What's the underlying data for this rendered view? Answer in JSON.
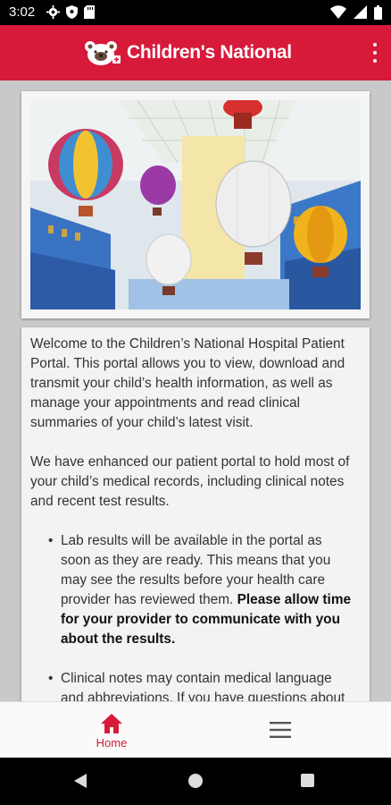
{
  "status_bar": {
    "time": "3:02",
    "left_icons": [
      "gear-icon",
      "shield-icon",
      "sd-card-icon"
    ],
    "right_icons": [
      "wifi-icon",
      "signal-icon",
      "battery-icon"
    ]
  },
  "app_bar": {
    "brand_name": "Children's National",
    "brand_color": "#d71a3a",
    "overflow_icon": "more-vertical-icon"
  },
  "hero_image": {
    "subject": "hot air balloons in hospital atrium"
  },
  "intro": {
    "paragraph1": "Welcome to the Children’s National Hospital Patient Portal. This portal allows you to view, download and transmit your child’s health information, as well as manage your appointments and read clinical summaries of your child’s latest visit.",
    "paragraph2": "We have enhanced our patient portal to hold most of your child’s medical records, including clinical notes and recent test results.",
    "bullet1_text": "Lab results will be available in the portal as soon as they are ready. This means that you may see the results before your health care provider has reviewed them. ",
    "bullet1_bold": "Please allow time for your provider to communicate with you about the results.",
    "bullet2_text": "Clinical notes may contain medical language and abbreviations. If you have questions about"
  },
  "bottom_nav": {
    "home_label": "Home",
    "home_icon": "home-icon",
    "menu_icon": "hamburger-menu-icon",
    "active_color": "#d71a3a"
  },
  "system_nav": {
    "back": "back-icon",
    "home": "home-circle-icon",
    "recents": "recents-icon"
  }
}
